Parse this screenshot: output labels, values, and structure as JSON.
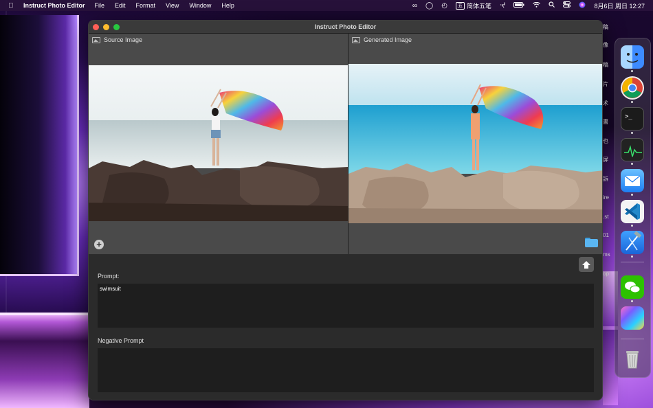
{
  "menubar": {
    "app_name": "Instruct Photo Editor",
    "menus": [
      "File",
      "Edit",
      "Format",
      "View",
      "Window",
      "Help"
    ],
    "ime_badge": "五",
    "ime_label": "简体五笔",
    "clock": "8月6日 周日  12:27"
  },
  "window": {
    "title": "Instruct Photo Editor",
    "source_label": "Source Image",
    "generated_label": "Generated Image"
  },
  "form": {
    "prompt_label": "Prompt:",
    "prompt_value": "swimsuit",
    "negative_label": "Negative Prompt",
    "negative_value": ""
  },
  "background_text": [
    "稿",
    "像",
    "稿",
    "片",
    "术",
    "書",
    "也",
    "屏",
    "訴",
    "ire",
    ".st",
    "01",
    "ms",
    "op"
  ],
  "dock": {
    "apps": [
      "finder-icon",
      "chrome-icon",
      "terminal-icon",
      "activity-monitor-icon",
      "mail-icon",
      "vscode-icon",
      "xcode-icon",
      "wechat-icon",
      "photo-app-icon",
      "trash-icon"
    ]
  }
}
